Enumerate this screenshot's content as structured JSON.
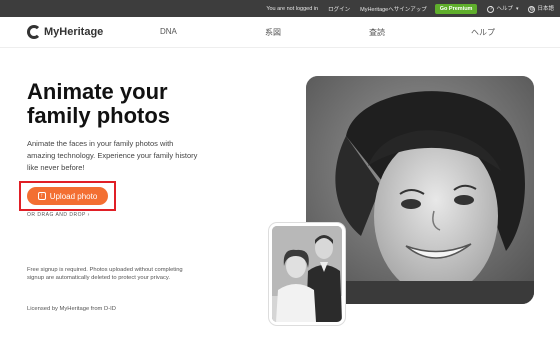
{
  "topbar": {
    "status": "You are not logged in",
    "login": "ログイン",
    "signup": "MyHeritageへサインアップ",
    "premium": "Go Premium",
    "help": "ヘルプ",
    "language": "日本語"
  },
  "nav": {
    "logo": "MyHeritage",
    "items": [
      "DNA",
      "系図",
      "査読",
      "ヘルプ"
    ]
  },
  "hero": {
    "title_line1": "Animate your",
    "title_line2": "family photos",
    "description": "Animate the faces in your family photos with amazing technology. Experience your family history like never before!",
    "upload_label": "Upload photo",
    "drag_label": "OR DRAG AND DROP",
    "notice": "Free signup is required. Photos uploaded without completing signup are automatically deleted to protect your privacy.",
    "license": "Licensed by MyHeritage from D-ID"
  },
  "colors": {
    "accent": "#f36f32",
    "highlight": "#e01f26",
    "premium": "#5fae2c",
    "topbar": "#3d3d3d"
  }
}
